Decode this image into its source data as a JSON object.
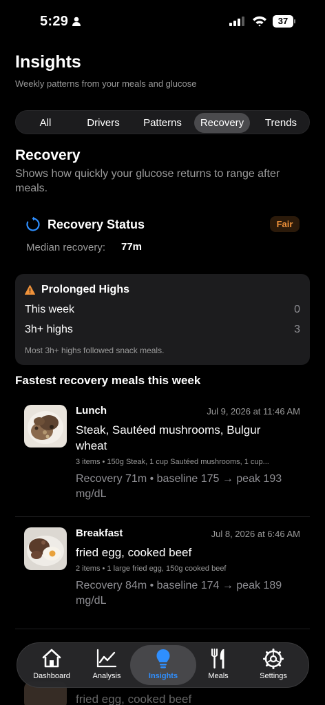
{
  "status_bar": {
    "time": "5:29",
    "battery": "37"
  },
  "header": {
    "title": "Insights",
    "subtitle": "Weekly patterns from your meals and glucose"
  },
  "tabs": [
    {
      "label": "All",
      "active": false
    },
    {
      "label": "Drivers",
      "active": false
    },
    {
      "label": "Patterns",
      "active": false
    },
    {
      "label": "Recovery",
      "active": true
    },
    {
      "label": "Trends",
      "active": false
    }
  ],
  "recovery": {
    "title": "Recovery",
    "description": "Shows how quickly your glucose returns to range after meals.",
    "status_title": "Recovery Status",
    "status_badge": "Fair",
    "median_label": "Median recovery:",
    "median_value": "77m"
  },
  "prolonged_highs": {
    "title": "Prolonged Highs",
    "rows": [
      {
        "label": "This week",
        "value": "0"
      },
      {
        "label": "3h+ highs",
        "value": "3"
      }
    ],
    "note": "Most 3h+ highs followed snack meals."
  },
  "fastest_meals": {
    "heading": "Fastest recovery meals this week",
    "items": [
      {
        "type": "Lunch",
        "date": "Jul 9, 2026 at 11:46 AM",
        "name": "Steak, Sautéed mushrooms, Bulgur wheat",
        "items": "3 items • 150g Steak, 1 cup Sautéed mushrooms, 1 cup...",
        "recovery": "Recovery 71m • baseline 175 → peak 193 mg/dL"
      },
      {
        "type": "Breakfast",
        "date": "Jul 8, 2026 at 6:46 AM",
        "name": "fried egg, cooked beef",
        "items": "2 items • 1 large fried egg, 150g cooked beef",
        "recovery": "Recovery 84m • baseline 174 → peak 189 mg/dL"
      }
    ]
  },
  "behind_tab_bar": {
    "meal_name": "fried egg, cooked beef"
  },
  "tab_bar": [
    {
      "label": "Dashboard",
      "icon": "house-icon"
    },
    {
      "label": "Analysis",
      "icon": "chart-line-icon"
    },
    {
      "label": "Insights",
      "icon": "lightbulb-icon",
      "active": true
    },
    {
      "label": "Meals",
      "icon": "fork-knife-icon"
    },
    {
      "label": "Settings",
      "icon": "gear-icon"
    }
  ],
  "colors": {
    "accent_blue": "#2f8fff",
    "badge_orange": "#f0923a",
    "warning_orange": "#f0923a"
  }
}
